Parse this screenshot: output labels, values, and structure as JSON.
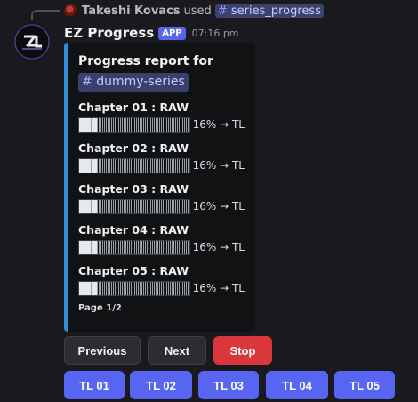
{
  "reply": {
    "user": "Takeshi Kovacs",
    "used": "used",
    "command": "series_progress",
    "command_hash": "#"
  },
  "bot": {
    "name": "EZ Progress",
    "badge": "APP",
    "timestamp": "07:16 pm"
  },
  "embed": {
    "title": "Progress report for",
    "channel_hash": "#",
    "channel": "dummy-series",
    "accent": "#2f8fd8",
    "page": "Page 1/2",
    "chapters": [
      {
        "name": "Chapter 01 : RAW",
        "progress_pct": 16,
        "status": "16% → TL"
      },
      {
        "name": "Chapter 02 : RAW",
        "progress_pct": 16,
        "status": "16% → TL"
      },
      {
        "name": "Chapter 03 : RAW",
        "progress_pct": 16,
        "status": "16% → TL"
      },
      {
        "name": "Chapter 04 : RAW",
        "progress_pct": 16,
        "status": "16% → TL"
      },
      {
        "name": "Chapter 05 : RAW",
        "progress_pct": 16,
        "status": "16% → TL"
      }
    ]
  },
  "nav_buttons": {
    "previous": "Previous",
    "next": "Next",
    "stop": "Stop"
  },
  "tl_buttons": [
    "TL 01",
    "TL 02",
    "TL 03",
    "TL 04",
    "TL 05"
  ],
  "colors": {
    "primary": "#5865f2",
    "danger": "#da373c",
    "secondary": "#2b2d31"
  }
}
